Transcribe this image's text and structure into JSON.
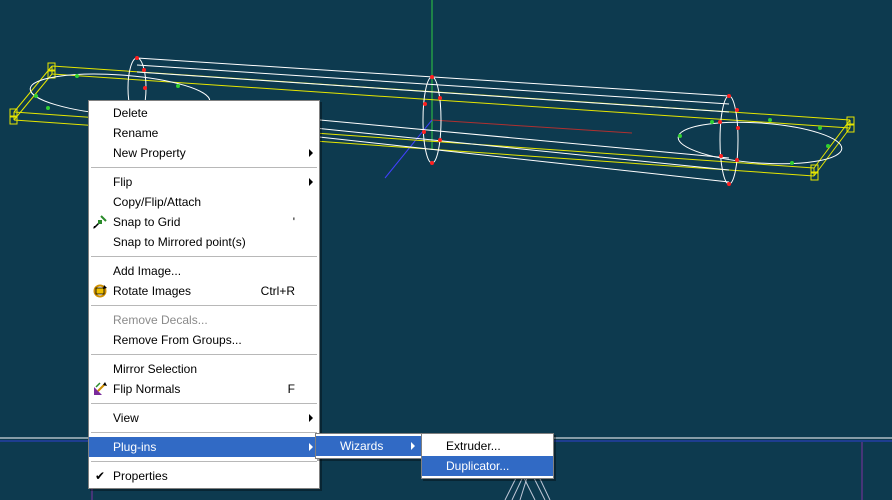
{
  "colors": {
    "viewport_bg": "#0d3a4f",
    "wire_yellow": "#e6e600",
    "wire_white": "#ffffff",
    "vertex_red": "#ff2020",
    "vertex_green": "#30d030",
    "axis_green": "#2ecc40",
    "axis_red": "#b03030",
    "axis_blue": "#4040ff",
    "highlight": "#316ac5"
  },
  "context_menu": {
    "items": [
      {
        "label": "Delete"
      },
      {
        "label": "Rename"
      },
      {
        "label": "New Property",
        "submenu": true
      },
      {
        "separator": true
      },
      {
        "label": "Flip",
        "submenu": true
      },
      {
        "label": "Copy/Flip/Attach"
      },
      {
        "label": "Snap to Grid",
        "shortcut": "'",
        "icon": "snap-grid-icon"
      },
      {
        "label": "Snap to Mirrored point(s)"
      },
      {
        "separator": true
      },
      {
        "label": "Add Image..."
      },
      {
        "label": "Rotate Images",
        "shortcut": "Ctrl+R",
        "icon": "rotate-images-icon"
      },
      {
        "separator": true
      },
      {
        "label": "Remove Decals...",
        "disabled": true
      },
      {
        "label": "Remove From Groups..."
      },
      {
        "separator": true
      },
      {
        "label": "Mirror Selection"
      },
      {
        "label": "Flip Normals",
        "shortcut": "F",
        "icon": "flip-normals-icon"
      },
      {
        "separator": true
      },
      {
        "label": "View",
        "submenu": true
      },
      {
        "separator": true
      },
      {
        "label": "Plug-ins",
        "submenu": true,
        "highlighted": true
      },
      {
        "separator": true
      },
      {
        "label": "Properties",
        "checked": true
      }
    ]
  },
  "plugins_submenu": {
    "items": [
      {
        "label": "Wizards",
        "submenu": true,
        "highlighted": true
      }
    ]
  },
  "wizards_submenu": {
    "items": [
      {
        "label": "Extruder..."
      },
      {
        "label": "Duplicator...",
        "highlighted": true
      }
    ]
  }
}
